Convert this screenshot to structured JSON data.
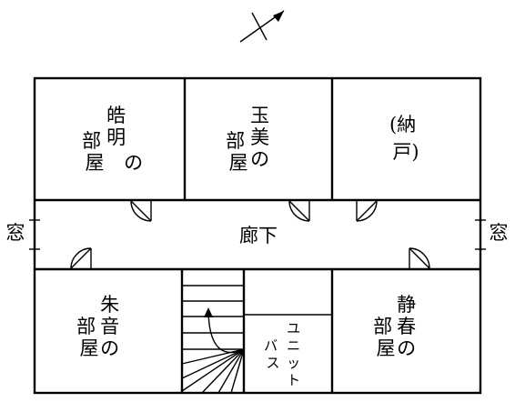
{
  "floorplan": {
    "rooms": {
      "kiaki": {
        "lines": [
          "皓",
          "明",
          "の",
          "部",
          "屋"
        ]
      },
      "tamami": {
        "lines": [
          "玉",
          "美",
          "の",
          "部",
          "屋"
        ]
      },
      "nando": {
        "lines": [
          "(納",
          "戸)"
        ]
      },
      "akane": {
        "lines": [
          "朱",
          "音",
          "の",
          "部",
          "屋"
        ]
      },
      "shizuka": {
        "lines": [
          "静",
          "春",
          "の",
          "部",
          "屋"
        ]
      }
    },
    "corridor": "廊下",
    "window_left": "窓",
    "window_right": "窓",
    "unit_bath": {
      "col1": [
        "ユ",
        "ニ",
        "ッ",
        "ト"
      ],
      "col2": [
        "バ",
        "ス"
      ]
    }
  }
}
